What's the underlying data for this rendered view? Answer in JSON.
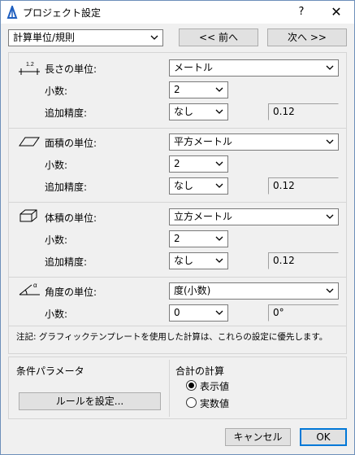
{
  "window": {
    "title": "プロジェクト設定",
    "help": "?",
    "close": "✕"
  },
  "nav": {
    "section_select": "計算単位/規則",
    "prev_button": "<< 前へ",
    "next_button": "次へ >>"
  },
  "length": {
    "label": "長さの単位:",
    "unit": "メートル",
    "decimals_label": "小数:",
    "decimals": "2",
    "extra_precision_label": "追加精度:",
    "extra_precision": "なし",
    "preview": "0.12",
    "icon_text": "1.2"
  },
  "area": {
    "label": "面積の単位:",
    "unit": "平方メートル",
    "decimals_label": "小数:",
    "decimals": "2",
    "extra_precision_label": "追加精度:",
    "extra_precision": "なし",
    "preview": "0.12"
  },
  "volume": {
    "label": "体積の単位:",
    "unit": "立方メートル",
    "decimals_label": "小数:",
    "decimals": "2",
    "extra_precision_label": "追加精度:",
    "extra_precision": "なし",
    "preview": "0.12"
  },
  "angle": {
    "label": "角度の単位:",
    "unit": "度(小数)",
    "decimals_label": "小数:",
    "decimals": "0",
    "preview": "0°",
    "icon_text": "α"
  },
  "note": "注記: グラフィックテンプレートを使用した計算は、これらの設定に優先します。",
  "conditions": {
    "label": "条件パラメータ",
    "rules_button": "ルールを設定..."
  },
  "totals": {
    "label": "合計の計算",
    "options": [
      "表示値",
      "実数値"
    ],
    "selected": "表示値"
  },
  "footer": {
    "cancel": "キャンセル",
    "ok": "OK"
  },
  "colors": {
    "accent": "#0078d7",
    "app_icon": "#1f5fbf"
  }
}
